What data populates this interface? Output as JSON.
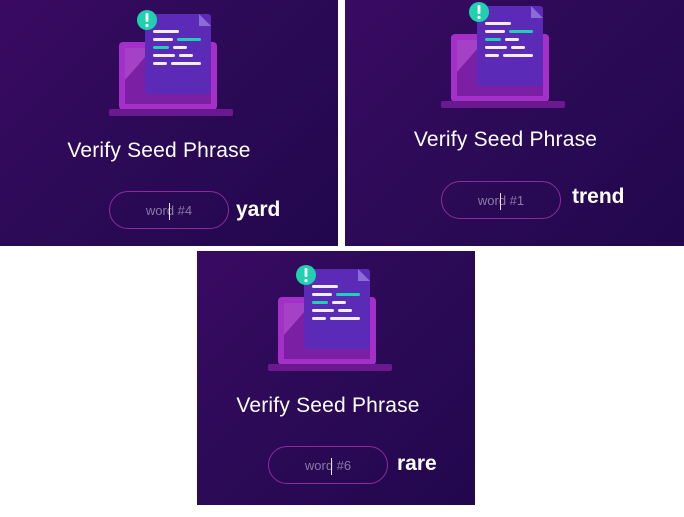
{
  "panels": [
    {
      "title": "Verify Seed Phrase",
      "placeholder": "word #4",
      "answer": "yard"
    },
    {
      "title": "Verify Seed Phrase",
      "placeholder": "word #1",
      "answer": "trend"
    },
    {
      "title": "Verify Seed Phrase",
      "placeholder": "word #6",
      "answer": "rare"
    }
  ],
  "icons": {
    "illustration": "laptop-document-icon",
    "badge": "exclamation-badge-icon"
  },
  "colors": {
    "background": "#2c0a57",
    "accent_teal": "#1fd1b0",
    "input_border": "#8e2a9d",
    "laptop": "#b23ad6"
  }
}
